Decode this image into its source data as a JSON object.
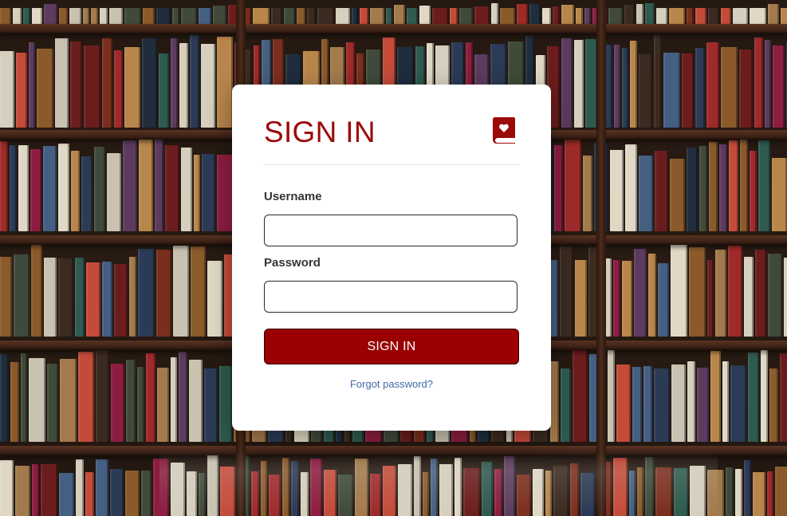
{
  "login": {
    "title": "SIGN IN",
    "username_label": "Username",
    "username_value": "",
    "password_label": "Password",
    "password_value": "",
    "submit_label": "SIGN IN",
    "forgot_link": "Forgot password?"
  },
  "icons": {
    "logo": "book-heart-icon"
  },
  "colors": {
    "accent": "#9b0a0a",
    "button": "#9a0101",
    "link": "#3e6aa8",
    "label": "#333333",
    "card": "#ffffff"
  }
}
